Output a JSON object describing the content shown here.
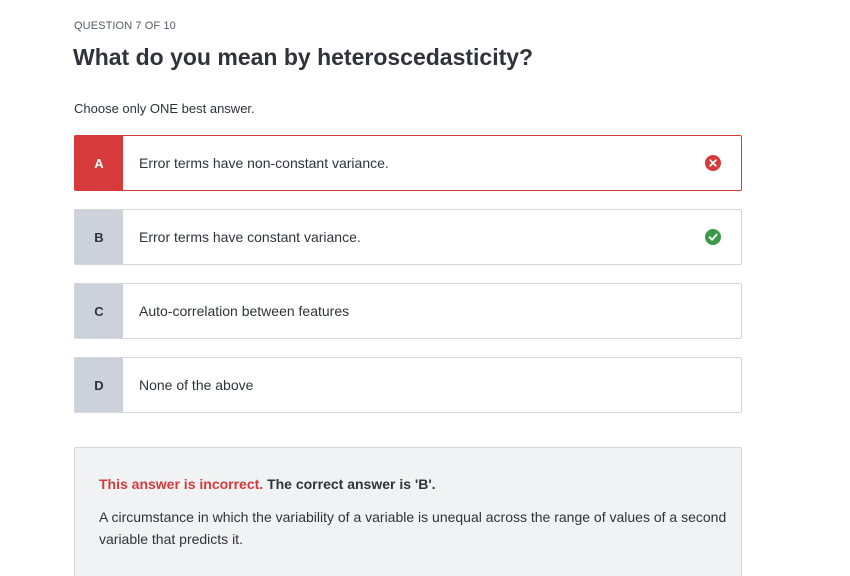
{
  "question": {
    "counter": "QUESTION 7 OF 10",
    "title": "What do you mean by heteroscedasticity?",
    "instruction": "Choose only ONE best answer."
  },
  "options": [
    {
      "letter": "A",
      "text": "Error terms have non-constant variance.",
      "status": "incorrect",
      "icon": "x-circle-icon"
    },
    {
      "letter": "B",
      "text": "Error terms have constant variance.",
      "status": "correct",
      "icon": "check-circle-icon"
    },
    {
      "letter": "C",
      "text": "Auto-correlation between features",
      "status": "none"
    },
    {
      "letter": "D",
      "text": "None of the above",
      "status": "none"
    }
  ],
  "feedback": {
    "verdict": "This answer is incorrect.",
    "correct_answer": "The correct answer is 'B'.",
    "explanation": "A circumstance in which the variability of a variable is unequal across the range of values of a second variable that predicts it."
  },
  "colors": {
    "incorrect": "#d63a3a",
    "correct": "#3a9a4a",
    "letter_bg": "#cdd1da",
    "feedback_bg": "#f1f2f4"
  }
}
